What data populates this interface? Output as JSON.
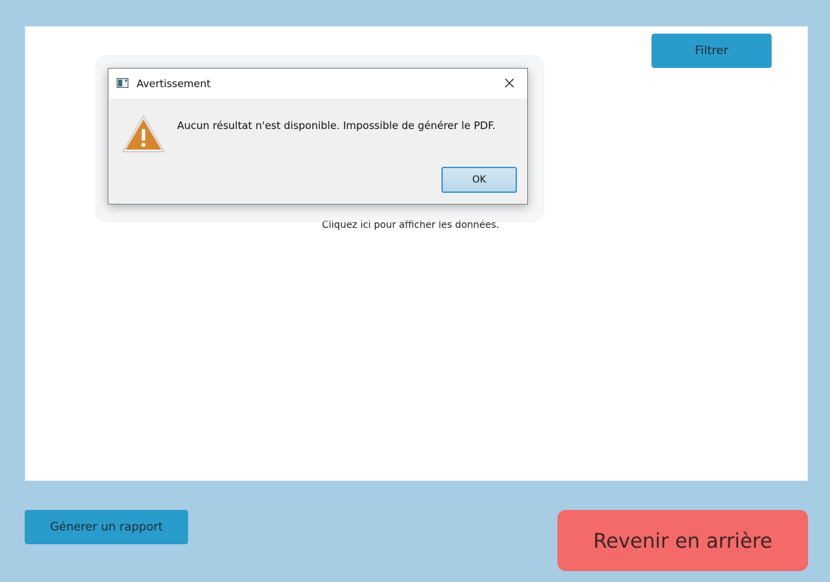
{
  "main": {
    "filter_label": "Filtrer",
    "hint_text": "Cliquez ici pour afficher les données."
  },
  "footer": {
    "report_label": "Génerer un rapport",
    "back_label": "Revenir en arrière"
  },
  "dialog": {
    "title": "Avertissement",
    "message": "Aucun résultat n'est disponible. Impossible de générer le PDF.",
    "ok_label": "OK",
    "icon": "warning-icon",
    "close_icon": "close-icon"
  },
  "colors": {
    "background": "#a6cde4",
    "button_blue": "#2a9ccb",
    "back_button": "#f46a68",
    "warning_orange": "#d7882c"
  }
}
